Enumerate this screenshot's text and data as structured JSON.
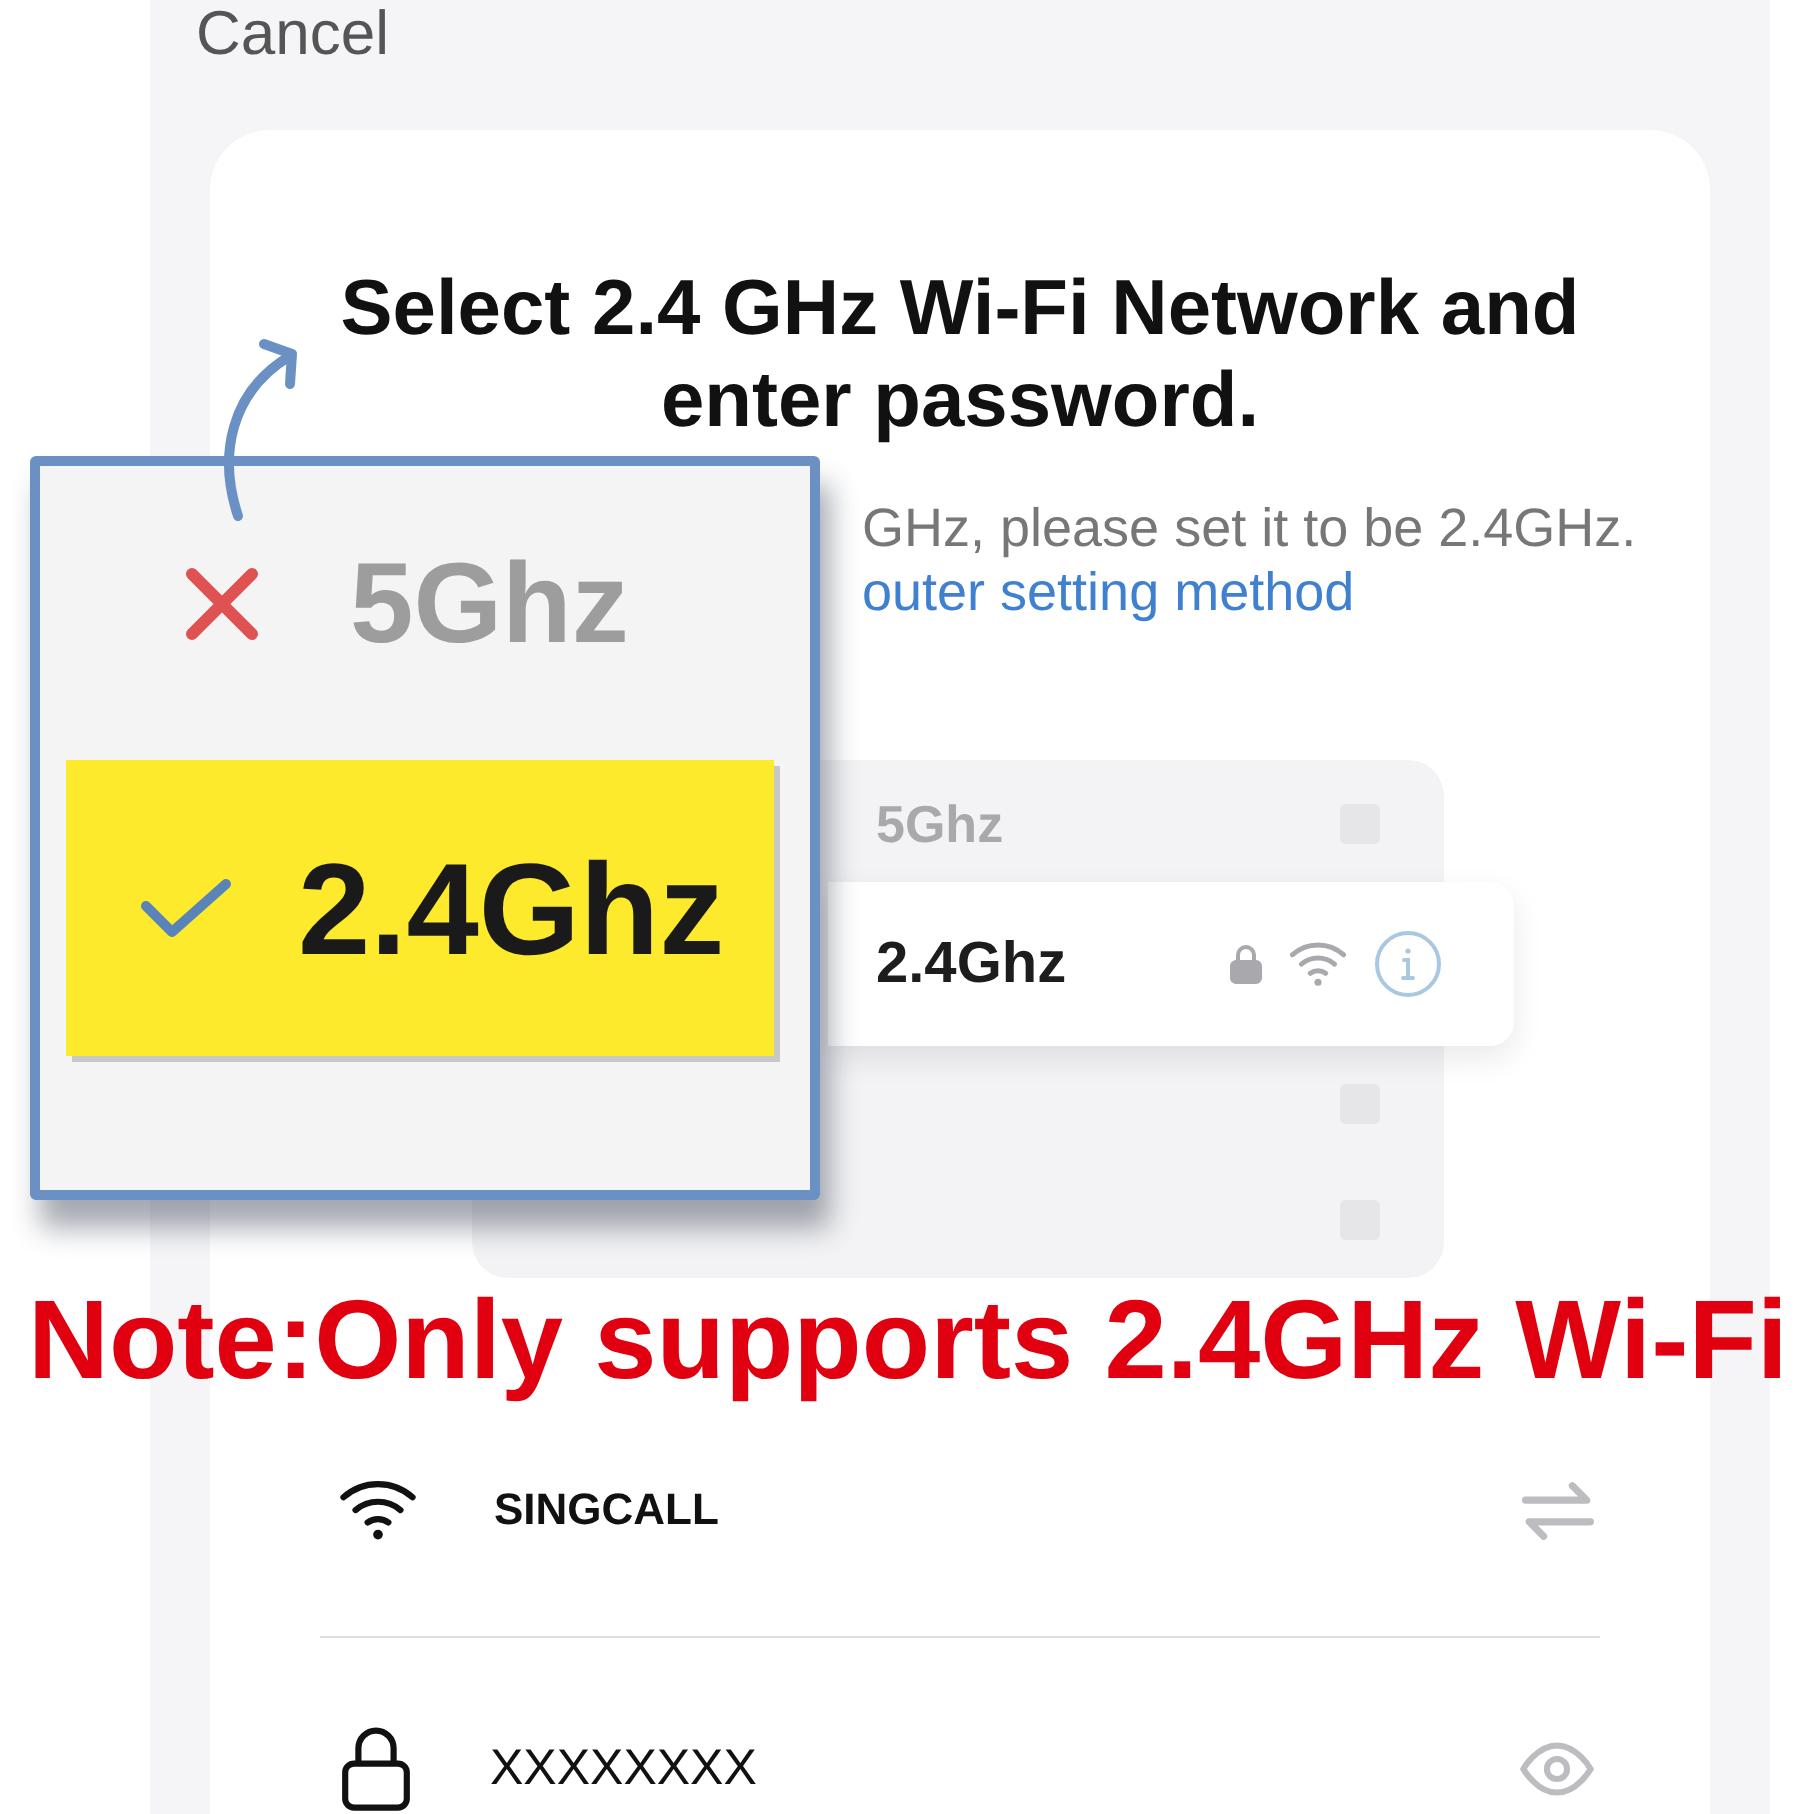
{
  "header": {
    "cancel": "Cancel"
  },
  "title": "Select 2.4 GHz Wi-Fi Network and enter password.",
  "hint": {
    "text": "GHz, please set it to be 2.4GHz.",
    "link": "outer setting method"
  },
  "networks": [
    {
      "name": "5Ghz",
      "selected": false
    },
    {
      "name": "2.4Ghz",
      "selected": true
    },
    {
      "selected": false
    },
    {
      "selected": false
    }
  ],
  "callout": {
    "items": [
      {
        "label": "5Ghz",
        "supported": false
      },
      {
        "label": "2.4Ghz",
        "supported": true
      }
    ]
  },
  "note": "Note:Only supports 2.4GHz Wi-Fi",
  "fields": [
    {
      "kind": "network",
      "value": "SINGCALL"
    },
    {
      "kind": "password",
      "value": "XXXXXXXX"
    }
  ]
}
